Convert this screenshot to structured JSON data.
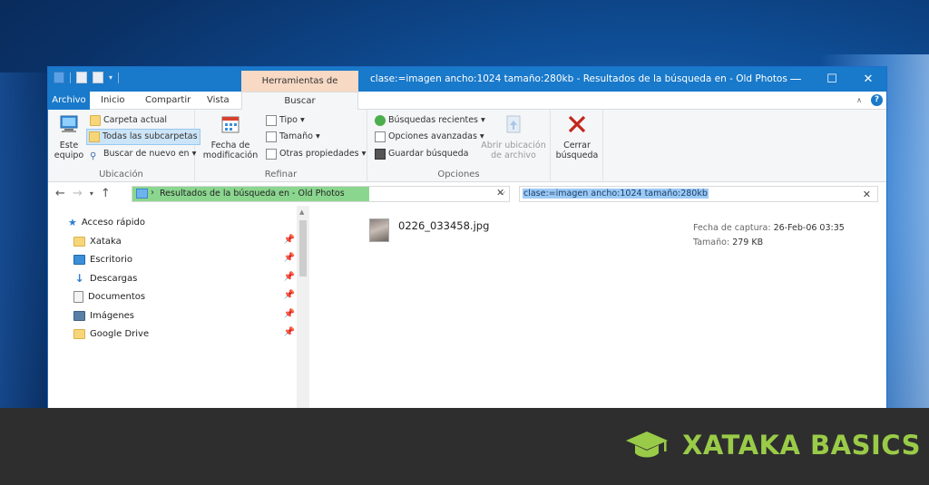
{
  "window": {
    "title": "clase:=imagen ancho:1024 tamaño:280kb - Resultados de la búsqueda en - Old Photos",
    "context_tab": "Herramientas de búsqueda",
    "controls": {
      "minimize": "—",
      "maximize": "☐",
      "close": "✕"
    }
  },
  "tabs": [
    "Archivo",
    "Inicio",
    "Compartir",
    "Vista",
    "Buscar"
  ],
  "ribbon": {
    "ubicacion": {
      "label": "Ubicación",
      "este_equipo": "Este equipo",
      "carpeta_actual": "Carpeta actual",
      "todas_subcarpetas": "Todas las subcarpetas",
      "buscar_nuevo": "Buscar de nuevo en"
    },
    "refinar": {
      "label": "Refinar",
      "fecha_modificacion": "Fecha de modificación",
      "tipo": "Tipo",
      "tamano": "Tamaño",
      "otras_propiedades": "Otras propiedades"
    },
    "opciones": {
      "label": "Opciones",
      "busquedas_recientes": "Búsquedas recientes",
      "opciones_avanzadas": "Opciones avanzadas",
      "guardar_busqueda": "Guardar búsqueda",
      "abrir_ubicacion": "Abrir ubicación de archivo"
    },
    "cerrar": "Cerrar búsqueda"
  },
  "address": {
    "path": "Resultados de la búsqueda en - Old Photos",
    "search_query": "clase:=imagen ancho:1024 tamaño:280kb"
  },
  "nav_pane": {
    "quick_access": "Acceso rápido",
    "items": [
      "Xataka",
      "Escritorio",
      "Descargas",
      "Documentos",
      "Imágenes",
      "Google Drive"
    ]
  },
  "results": [
    {
      "name": "0226_033458.jpg",
      "capture_label": "Fecha de captura:",
      "capture_value": "26-Feb-06 03:35",
      "size_label": "Tamaño:",
      "size_value": "279 KB"
    }
  ],
  "brand": "XATAKA BASICS",
  "colors": {
    "accent": "#1979ca",
    "context_tab": "#f7d9c4",
    "path_fill": "#8bd68f",
    "brand": "#9acb48"
  }
}
